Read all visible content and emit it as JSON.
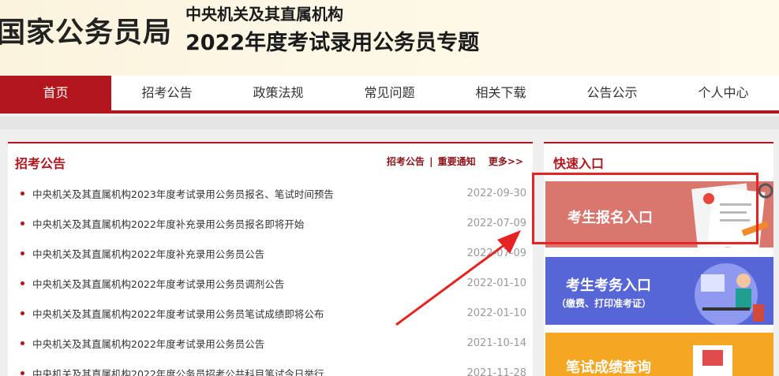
{
  "header": {
    "logo": "国家公务员局",
    "line1": "中央机关及其直属机构",
    "line2": "2022年度考试录用公务员专题"
  },
  "nav": [
    "首页",
    "招考公告",
    "政策法规",
    "常见问题",
    "相关下载",
    "公告公示",
    "个人中心"
  ],
  "news": {
    "title": "招考公告",
    "link1": "招考公告",
    "sep": "|",
    "link2": "重要通知",
    "more": "更多>>",
    "items": [
      {
        "title": "中央机关及其直属机构2023年度考试录用公务员报名、笔试时间预告",
        "date": "2022-09-30"
      },
      {
        "title": "中央机关及其直属机构2022年度补充录用公务员报名即将开始",
        "date": "2022-07-09"
      },
      {
        "title": "中央机关及其直属机构2022年度补充录用公务员公告",
        "date": "2022-07-09"
      },
      {
        "title": "中央机关及其直属机构2022年度考试录用公务员调剂公告",
        "date": "2022-01-10"
      },
      {
        "title": "中央机关及其直属机构2022年度考试录用公务员笔试成绩即将公布",
        "date": "2022-01-10"
      },
      {
        "title": "中央机关及其直属机构2022年度考试录用公务员公告",
        "date": "2021-10-14"
      },
      {
        "title": "中央机关及其直属机构2022年度公务员招考公共科目笔试今日举行",
        "date": "2021-11-28"
      }
    ]
  },
  "quick": {
    "title": "快速入口",
    "b1": "考生报名入口",
    "b2": "考生考务入口",
    "b2sub": "（缴费、打印准考证）",
    "b3": "笔试成绩查询"
  },
  "colors": {
    "brand_red": "#b2161d",
    "highlight": "#e62323"
  }
}
